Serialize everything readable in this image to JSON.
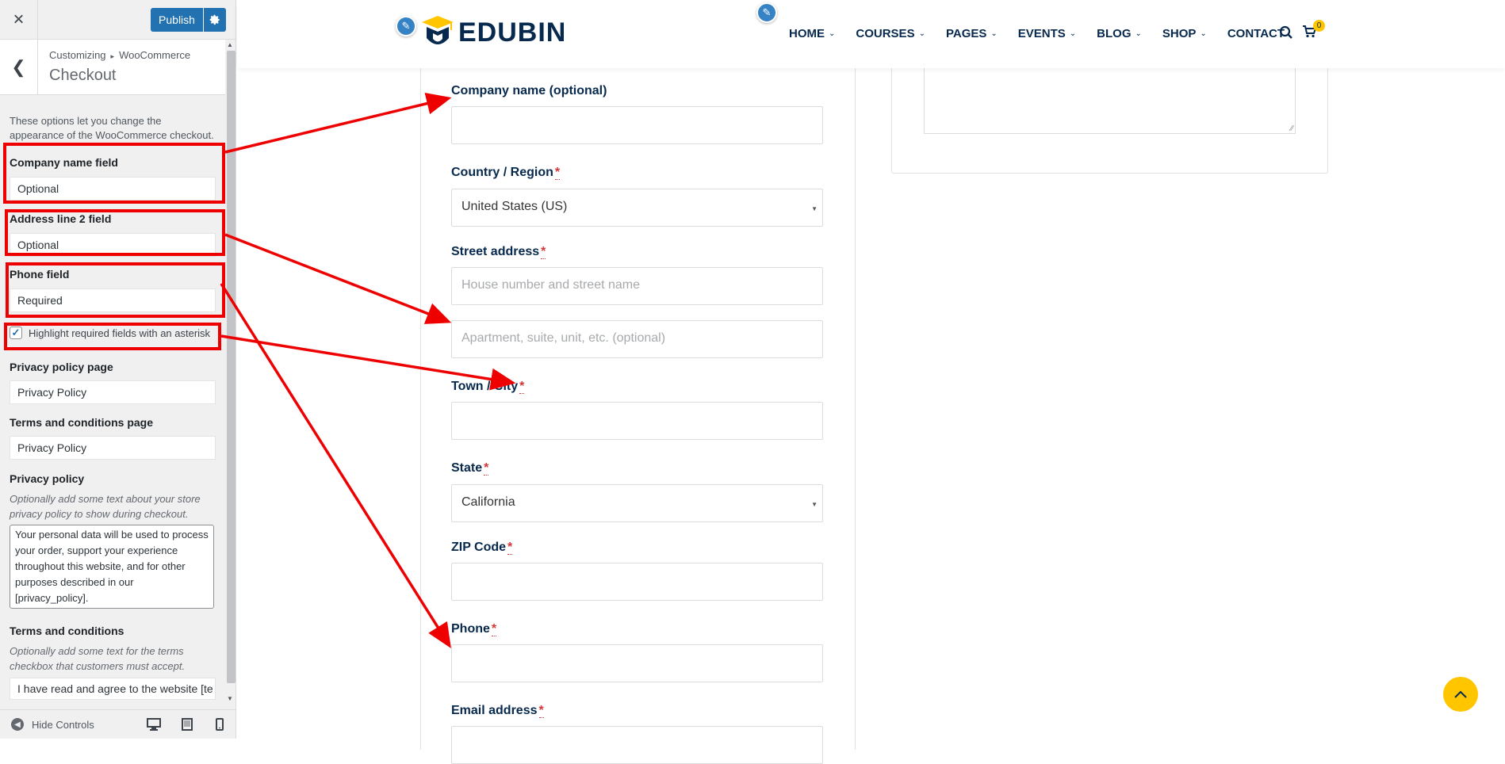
{
  "sidebar": {
    "close_label": "×",
    "publish_label": "Publish",
    "breadcrumb_root": "Customizing",
    "breadcrumb_section": "WooCommerce",
    "section_title": "Checkout",
    "description": "These options let you change the appearance of the WooCommerce checkout.",
    "company_field": {
      "label": "Company name field",
      "value": "Optional"
    },
    "address2_field": {
      "label": "Address line 2 field",
      "value": "Optional"
    },
    "phone_field": {
      "label": "Phone field",
      "value": "Required"
    },
    "highlight_checkbox": {
      "label": "Highlight required fields with an asterisk",
      "checked": true
    },
    "privacy_page": {
      "label": "Privacy policy page",
      "value": "Privacy Policy"
    },
    "terms_page": {
      "label": "Terms and conditions page",
      "value": "Privacy Policy"
    },
    "privacy_policy": {
      "label": "Privacy policy",
      "description": "Optionally add some text about your store privacy policy to show during checkout.",
      "value": "Your personal data will be used to process your order, support your experience throughout this website, and for other purposes described in our [privacy_policy]."
    },
    "terms": {
      "label": "Terms and conditions",
      "description": "Optionally add some text for the terms checkbox that customers must accept.",
      "value": "I have read and agree to the website [te"
    },
    "hide_controls_label": "Hide Controls"
  },
  "site": {
    "logo_text": "EDUBIN",
    "nav": [
      {
        "label": "HOME",
        "dropdown": true
      },
      {
        "label": "COURSES",
        "dropdown": true
      },
      {
        "label": "PAGES",
        "dropdown": true
      },
      {
        "label": "EVENTS",
        "dropdown": true
      },
      {
        "label": "BLOG",
        "dropdown": true
      },
      {
        "label": "SHOP",
        "dropdown": true
      },
      {
        "label": "CONTACT",
        "dropdown": false
      }
    ],
    "cart_count": "0"
  },
  "checkout": {
    "company": {
      "label": "Company name (optional)"
    },
    "country": {
      "label": "Country / Region",
      "value": "United States (US)"
    },
    "street": {
      "label": "Street address",
      "placeholder1": "House number and street name",
      "placeholder2": "Apartment, suite, unit, etc. (optional)"
    },
    "city": {
      "label": "Town / City"
    },
    "state": {
      "label": "State",
      "value": "California"
    },
    "zip": {
      "label": "ZIP Code"
    },
    "phone": {
      "label": "Phone"
    },
    "email": {
      "label": "Email address"
    },
    "required_mark": "*"
  },
  "colors": {
    "annotation_red": "#ee0000",
    "brand_navy": "#07294d",
    "brand_yellow": "#ffc600",
    "wp_blue": "#2271b1"
  }
}
